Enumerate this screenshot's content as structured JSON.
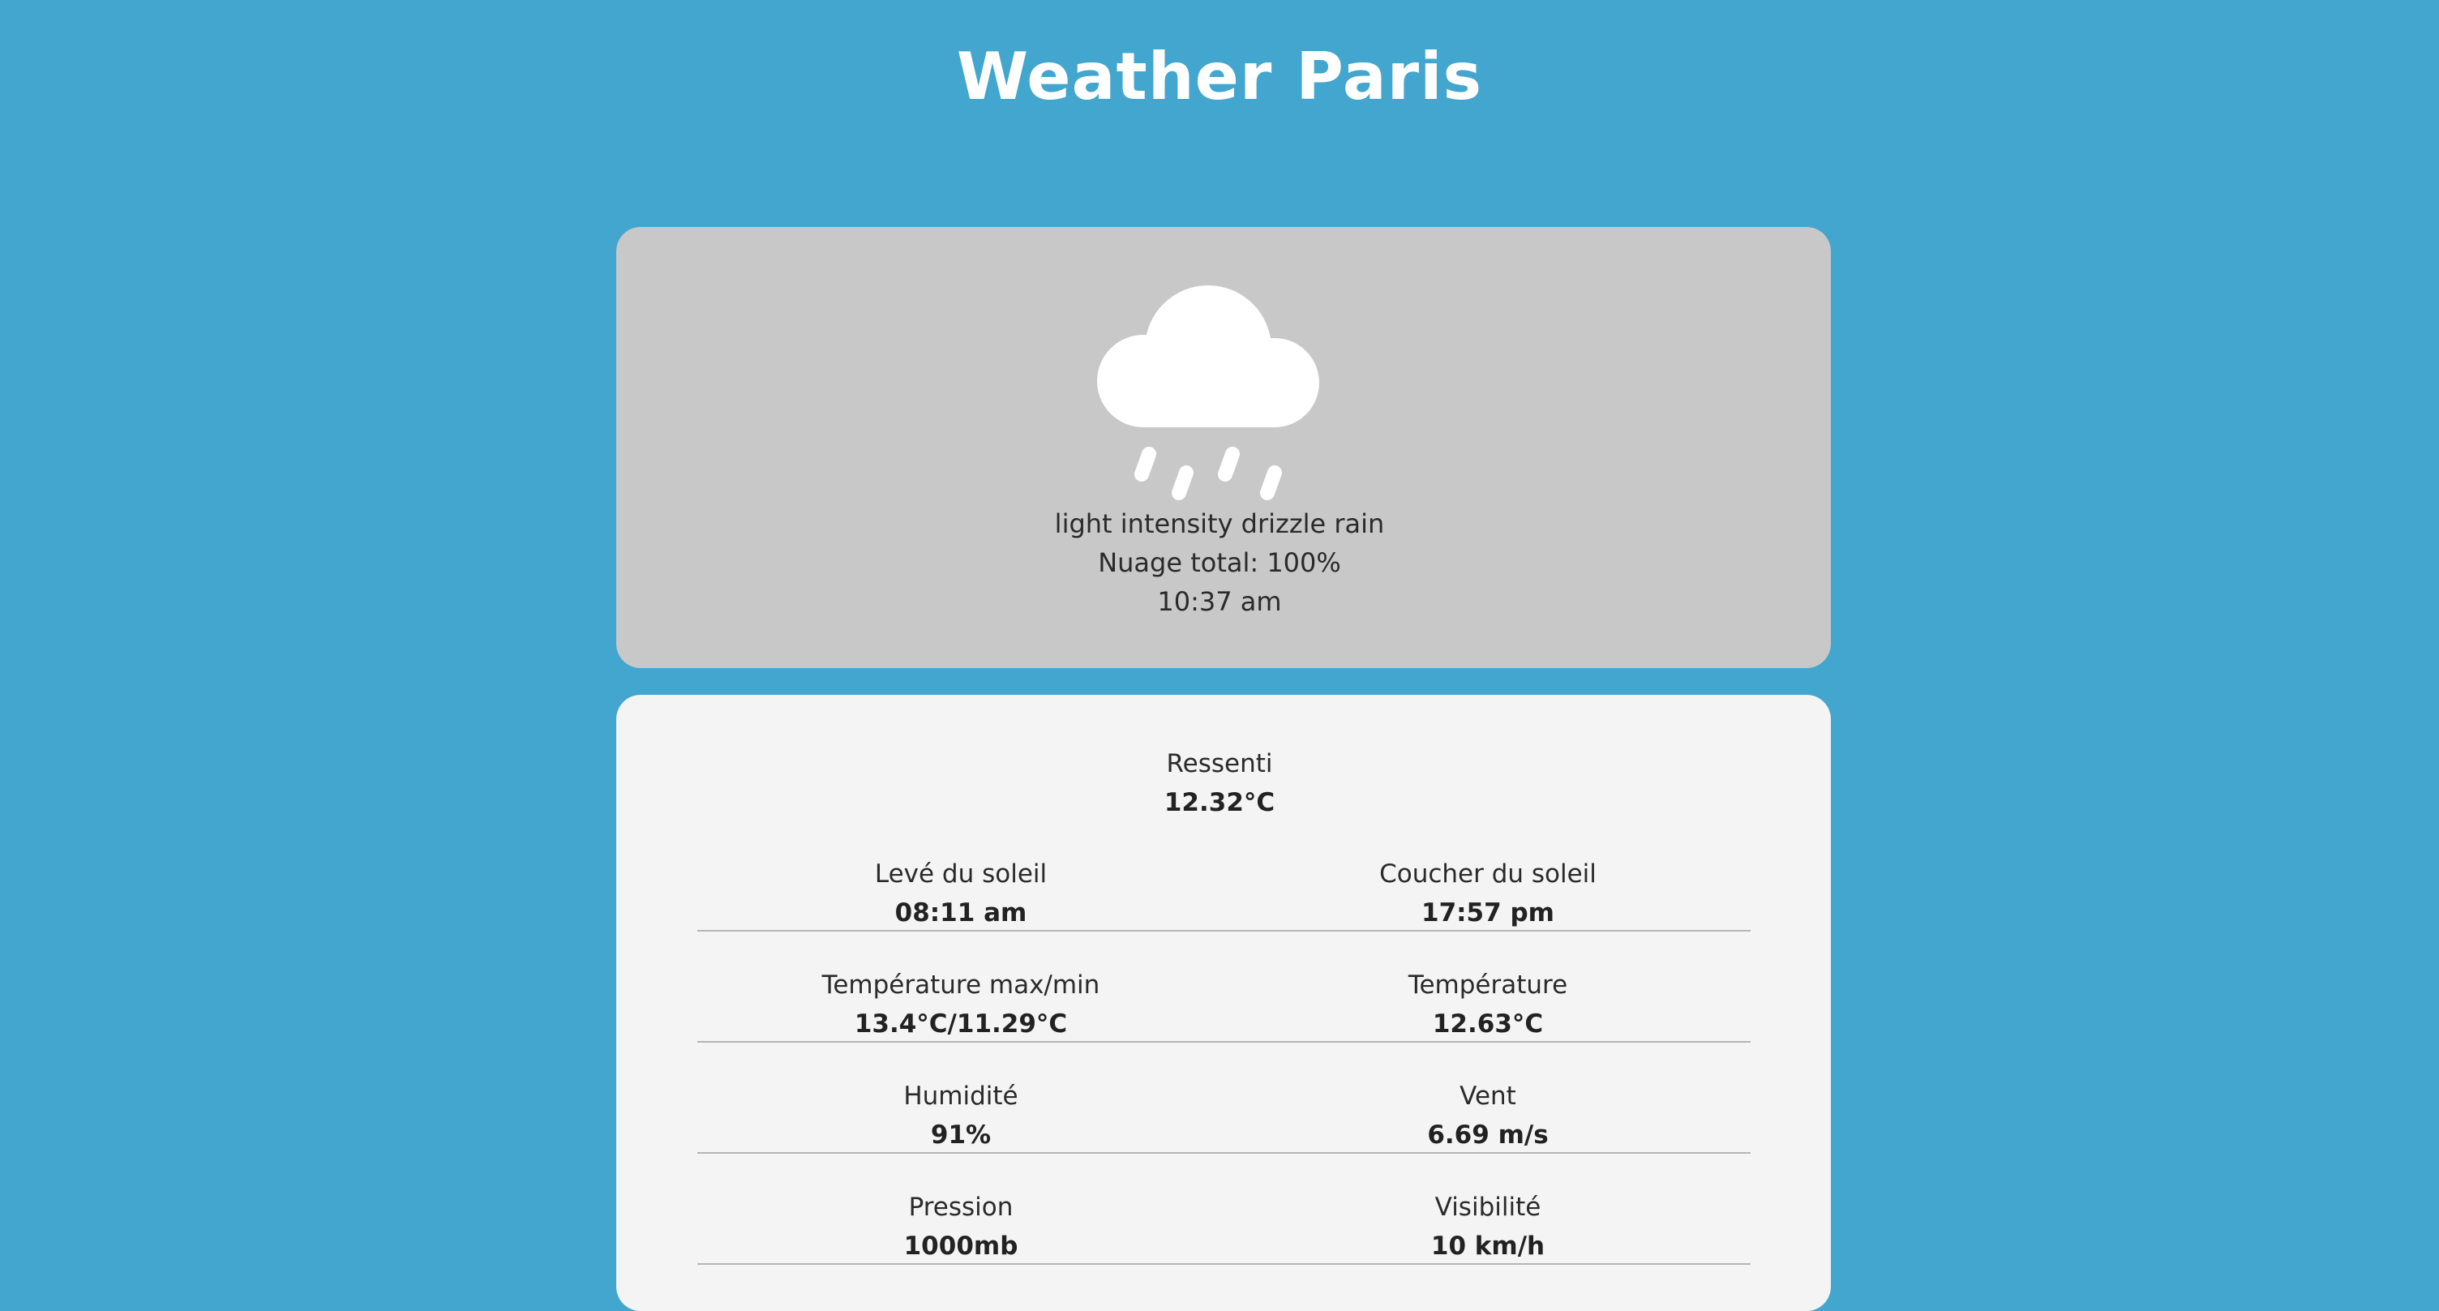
{
  "header": {
    "title": "Weather Paris"
  },
  "current": {
    "icon": "cloud-rain-icon",
    "description": "light intensity drizzle rain",
    "cloud_cover": "Nuage total: 100%",
    "time": "10:37 am"
  },
  "details": {
    "feels_like": {
      "label": "Ressenti",
      "value": "12.32°C"
    },
    "sunrise": {
      "label": "Levé du soleil",
      "value": "08:11 am"
    },
    "sunset": {
      "label": "Coucher du soleil",
      "value": "17:57 pm"
    },
    "temp_maxmin": {
      "label": "Température max/min",
      "value": "13.4°C/11.29°C"
    },
    "temperature": {
      "label": "Température",
      "value": "12.63°C"
    },
    "humidity": {
      "label": "Humidité",
      "value": "91%"
    },
    "wind": {
      "label": "Vent",
      "value": "6.69 m/s"
    },
    "pressure": {
      "label": "Pression",
      "value": "1000mb"
    },
    "visibility": {
      "label": "Visibilité",
      "value": "10 km/h"
    }
  },
  "colors": {
    "background": "#43a6ce",
    "top_card": "#c8c8c8",
    "bottom_card": "#f4f4f4",
    "title": "#ffffff"
  }
}
